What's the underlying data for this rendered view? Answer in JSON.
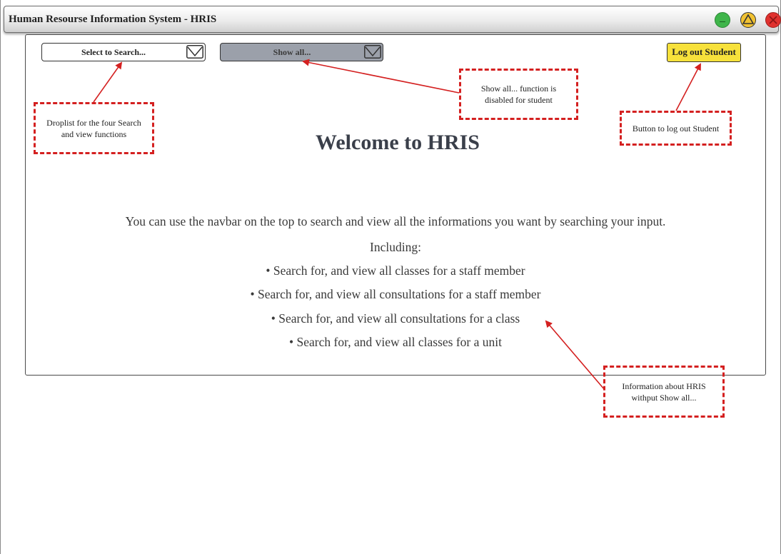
{
  "window": {
    "title": "Human Resourse Information System - HRIS",
    "controls": [
      "minimize-icon",
      "maximize-icon",
      "close-icon"
    ]
  },
  "navbar": {
    "search_dropdown": {
      "label": "Select to Search...",
      "icon": "chevron-down-icon"
    },
    "showall_dropdown": {
      "label": "Show all...",
      "icon": "chevron-down-icon"
    },
    "logout_label": "Log out Student"
  },
  "main": {
    "heading": "Welcome to HRIS",
    "intro": "You can use the navbar on the top to search and view all the informations you want by searching your input.",
    "including": "Including:",
    "items": [
      "• Search for, and view all classes for a staff member",
      "• Search for, and view all consultations for a staff member",
      "• Search for, and view all consultations for a class",
      "• Search for, and view all classes for a unit"
    ]
  },
  "annotations": {
    "droplist": [
      "Droplist for the four Search",
      "and view functions"
    ],
    "showall": [
      "Show all... function is",
      "disabled for student"
    ],
    "logout": [
      "Button to log out Student"
    ],
    "info": [
      "Information about HRIS",
      "withput Show all..."
    ]
  },
  "colors": {
    "accent_yellow": "#f7e13b",
    "annotation_red": "#d42020",
    "disabled_gray": "#9ba0aa",
    "minimize_green": "#3fb54a",
    "close_red": "#e0312e"
  }
}
